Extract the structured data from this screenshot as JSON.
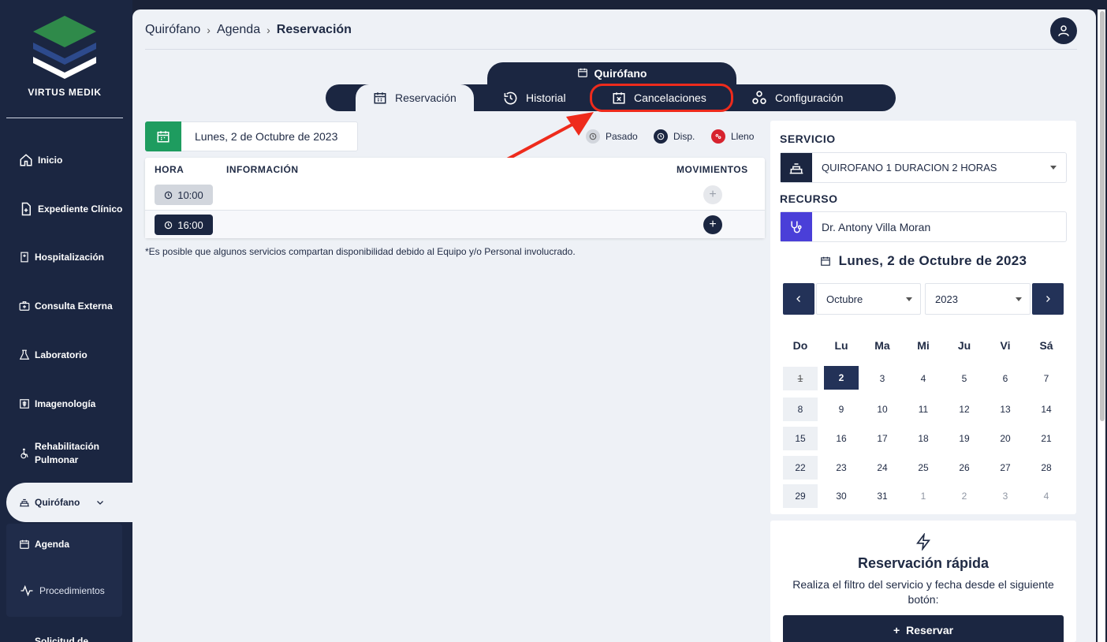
{
  "app": {
    "brand": "VIRTUS MEDIK"
  },
  "sidebar": {
    "items": [
      {
        "label": "Inicio",
        "icon": "home-icon"
      },
      {
        "label": "Expediente Clínico",
        "icon": "file-plus-icon"
      },
      {
        "label": "Hospitalización",
        "icon": "hospital-icon"
      },
      {
        "label": "Consulta Externa",
        "icon": "medkit-icon"
      },
      {
        "label": "Laboratorio",
        "icon": "flask-icon"
      },
      {
        "label": "Imagenología",
        "icon": "xray-icon"
      },
      {
        "label": "Rehabilitación Pulmonar",
        "icon": "wheelchair-icon"
      },
      {
        "label": "Quirófano",
        "icon": "operating-bed-icon"
      }
    ],
    "submenu": [
      {
        "label": "Agenda",
        "icon": "calendar-icon"
      },
      {
        "label": "Procedimientos",
        "icon": "pulse-icon"
      }
    ],
    "partial_item": "Solicitud de"
  },
  "breadcrumb": [
    "Quirófano",
    "Agenda",
    "Reservación"
  ],
  "module_title": "Quirófano",
  "tabs": [
    {
      "label": "Reservación",
      "icon": "calendar-grid-icon",
      "active": true
    },
    {
      "label": "Historial",
      "icon": "history-icon",
      "active": false
    },
    {
      "label": "Cancelaciones",
      "icon": "calendar-x-icon",
      "active": false,
      "highlighted": true
    },
    {
      "label": "Configuración",
      "icon": "shapes-icon",
      "active": false
    }
  ],
  "schedule": {
    "date": "Lunes, 2 de Octubre de 2023",
    "legend": [
      {
        "label": "Pasado",
        "color": "#d2d6dd"
      },
      {
        "label": "Disp.",
        "color": "#1b2641"
      },
      {
        "label": "Lleno",
        "color": "#d7232e"
      }
    ],
    "columns": [
      "HORA",
      "INFORMACIÓN",
      "MOVIMIENTOS"
    ],
    "rows": [
      {
        "time": "10:00",
        "status": "past"
      },
      {
        "time": "16:00",
        "status": "available"
      }
    ],
    "note": "*Es posible que algunos servicios compartan disponibilidad debido al Equipo y/o Personal involucrado."
  },
  "panel": {
    "service_label": "SERVICIO",
    "service_value": "QUIROFANO 1 DURACION 2 HORAS",
    "resource_label": "RECURSO",
    "resource_value": "Dr. Antony Villa Moran",
    "calendar_title": "Lunes, 2 de Octubre de 2023",
    "month": "Octubre",
    "year": "2023",
    "weekdays": [
      "Do",
      "Lu",
      "Ma",
      "Mi",
      "Ju",
      "Vi",
      "Sá"
    ],
    "weeks": [
      [
        "1",
        "2",
        "3",
        "4",
        "5",
        "6",
        "7"
      ],
      [
        "8",
        "9",
        "10",
        "11",
        "12",
        "13",
        "14"
      ],
      [
        "15",
        "16",
        "17",
        "18",
        "19",
        "20",
        "21"
      ],
      [
        "22",
        "23",
        "24",
        "25",
        "26",
        "27",
        "28"
      ],
      [
        "29",
        "30",
        "31",
        "1",
        "2",
        "3",
        "4"
      ]
    ],
    "selected_day": "2"
  },
  "quick": {
    "title": "Reservación rápida",
    "description": "Realiza el filtro del servicio y fecha desde el siguiente botón:",
    "button": "Reservar"
  },
  "colors": {
    "primary": "#1b2641",
    "accent_green": "#1e9c5f",
    "highlight_red": "#ee2b1c",
    "resource_purple": "#4a3fd8"
  }
}
